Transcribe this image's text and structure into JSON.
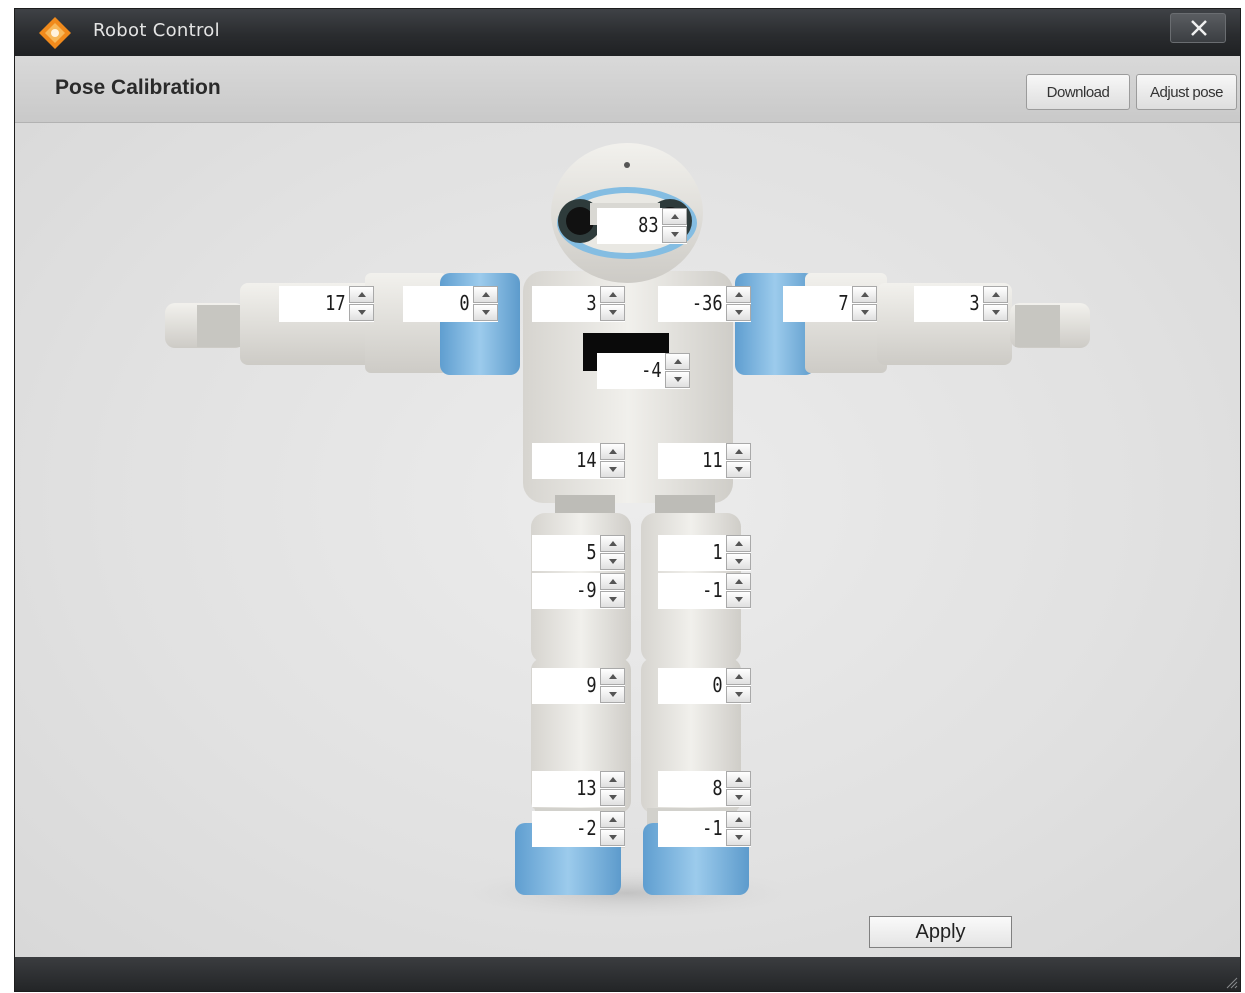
{
  "window": {
    "title": "Robot Control",
    "app_icon": "orange-diamond-logo-icon"
  },
  "header": {
    "title": "Pose Calibration",
    "download_label": "Download",
    "adjust_pose_label": "Adjust pose"
  },
  "joints": {
    "head": "83",
    "left_wrist": "17",
    "left_elbow": "0",
    "left_shoulder": "3",
    "right_shoulder": "-36",
    "right_elbow": "7",
    "right_wrist": "3",
    "chest": "-4",
    "left_hip": "14",
    "right_hip": "11",
    "left_upper_thigh": "5",
    "right_upper_thigh": "1",
    "left_lower_thigh": "-9",
    "right_lower_thigh": "-1",
    "left_knee": "9",
    "right_knee": "0",
    "left_ankle": "13",
    "right_ankle": "8",
    "left_foot": "-2",
    "right_foot": "-1"
  },
  "footer": {
    "apply_label": "Apply"
  },
  "colors": {
    "accent_blue": "#7ab4da",
    "body_white": "#ecebe6",
    "titlebar": "#2b2d30"
  }
}
